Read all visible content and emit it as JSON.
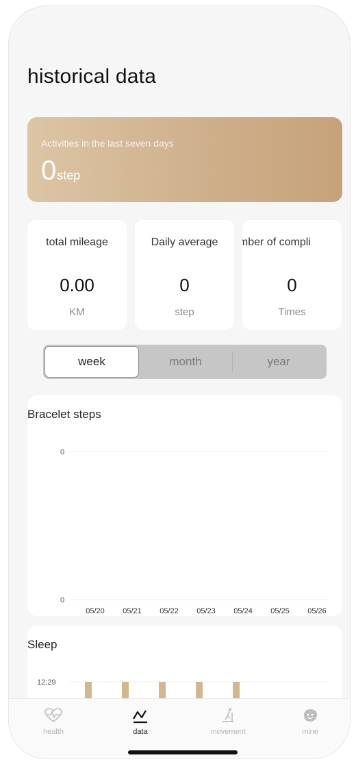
{
  "header": {
    "title": "historical data"
  },
  "summary": {
    "label": "Activities in the last seven days",
    "value": "0",
    "unit": "step"
  },
  "stats": [
    {
      "label": "total mileage",
      "value": "0.00",
      "unit": "KM"
    },
    {
      "label": "Daily average",
      "value": "0",
      "unit": "step"
    },
    {
      "label": "umber of compli",
      "value": "0",
      "unit": "Times"
    }
  ],
  "period_tabs": [
    {
      "label": "week",
      "active": true
    },
    {
      "label": "month",
      "active": false
    },
    {
      "label": "year",
      "active": false
    }
  ],
  "steps_chart": {
    "title": "Bracelet steps",
    "chart_data": {
      "type": "bar",
      "title": "Bracelet steps",
      "categories": [
        "05/20",
        "05/21",
        "05/22",
        "05/23",
        "05/24",
        "05/25",
        "05/26"
      ],
      "values": [
        0,
        0,
        0,
        0,
        0,
        0,
        0
      ],
      "y_ticks": [
        "0",
        "0"
      ],
      "grid": true
    }
  },
  "sleep_chart": {
    "title": "Sleep",
    "chart_data": {
      "type": "bar",
      "title": "Sleep",
      "y_tick": "12:29",
      "bars_visible": 5,
      "bar_color": "#d1b690"
    }
  },
  "tabbar": {
    "items": [
      {
        "label": "health",
        "icon": "heart-pulse-icon",
        "active": false
      },
      {
        "label": "data",
        "icon": "chart-line-icon",
        "active": true
      },
      {
        "label": "movement",
        "icon": "treadmill-icon",
        "active": false
      },
      {
        "label": "mine",
        "icon": "face-icon",
        "active": false
      }
    ]
  },
  "colors": {
    "accent_gold": "#cfb08c",
    "background": "#f6f6f6",
    "card": "#ffffff"
  }
}
